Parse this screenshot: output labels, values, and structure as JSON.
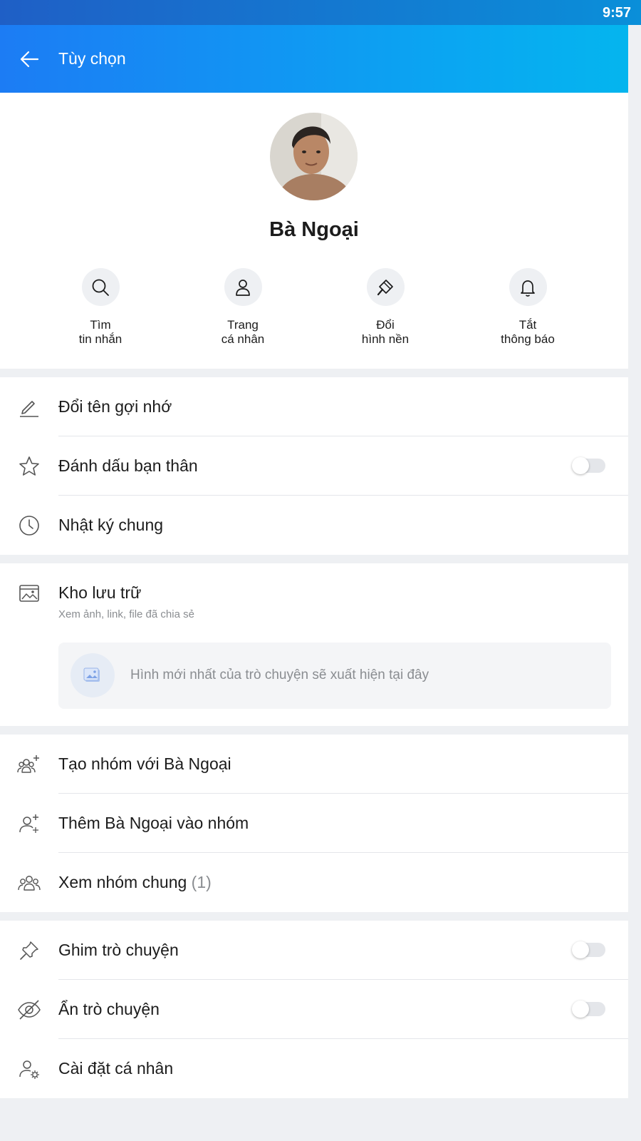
{
  "status_bar": {
    "time": "9:57"
  },
  "header": {
    "title": "Tùy chọn"
  },
  "profile": {
    "name": "Bà Ngoại",
    "actions": [
      {
        "line1": "Tìm",
        "line2": "tin nhắn",
        "icon": "search-icon"
      },
      {
        "line1": "Trang",
        "line2": "cá nhân",
        "icon": "user-icon"
      },
      {
        "line1": "Đổi",
        "line2": "hình nền",
        "icon": "paint-brush-icon"
      },
      {
        "line1": "Tắt",
        "line2": "thông báo",
        "icon": "bell-icon"
      }
    ]
  },
  "section1": [
    {
      "label": "Đổi tên gợi nhớ",
      "icon": "pencil-icon"
    },
    {
      "label": "Đánh dấu bạn thân",
      "icon": "star-icon",
      "toggle": false
    },
    {
      "label": "Nhật ký chung",
      "icon": "clock-icon"
    }
  ],
  "storage": {
    "title": "Kho lưu trữ",
    "subtitle": "Xem ảnh, link, file đã chia sẻ",
    "placeholder": "Hình mới nhất của trò chuyện sẽ xuất hiện tại đây"
  },
  "section3": [
    {
      "label": "Tạo nhóm với Bà Ngoại",
      "icon": "group-add-icon"
    },
    {
      "label": "Thêm Bà Ngoại vào nhóm",
      "icon": "user-add-icon"
    },
    {
      "label": "Xem nhóm chung",
      "count": "(1)",
      "icon": "group-icon"
    }
  ],
  "section4": [
    {
      "label": "Ghim trò chuyện",
      "icon": "pin-icon",
      "toggle": false
    },
    {
      "label": "Ẩn trò chuyện",
      "icon": "eye-off-icon",
      "toggle": false
    },
    {
      "label": "Cài đặt cá nhân",
      "icon": "user-settings-icon"
    }
  ],
  "colors": {
    "header_start": "#1c7cf4",
    "header_end": "#04b6ee",
    "accent": "#1c7cf4"
  }
}
